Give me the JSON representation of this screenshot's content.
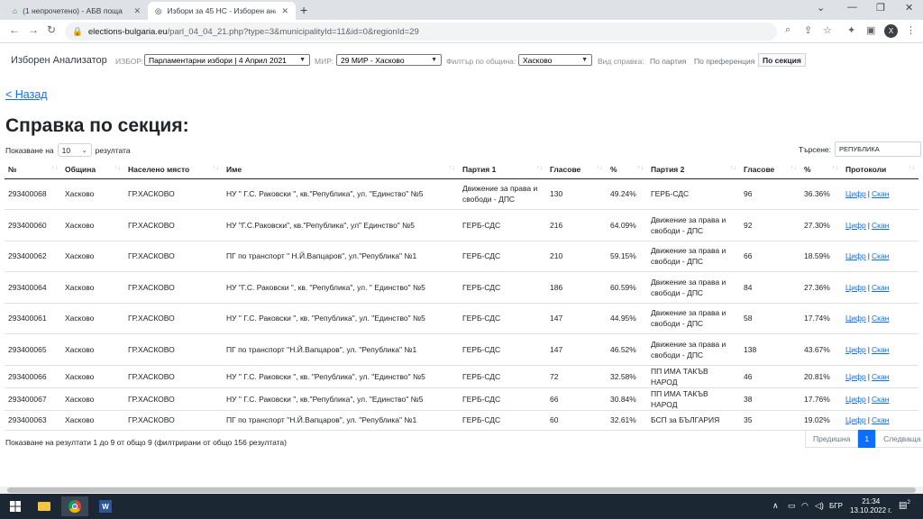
{
  "browser": {
    "tabs": [
      {
        "title": "(1 непрочетено) - АБВ поща"
      },
      {
        "title": "Избори за 45 НС - Изборен ана"
      }
    ],
    "url_domain": "elections-bulgaria.eu",
    "url_path": "/parl_04_04_21.php?type=3&municipalityId=11&id=0&regionId=29"
  },
  "nav": {
    "brand": "Изборен Анализатор",
    "election_label": "ИЗБОР:",
    "election_value": "Парламентарни избори | 4 Април 2021",
    "mir_label": "МИР:",
    "mir_value": "29 МИР - Хасково",
    "municipality_label": "Филтър по община:",
    "municipality_value": "Хасково",
    "report_label": "Вид справка:",
    "report_party": "По партия",
    "report_pref": "По преференция",
    "report_section": "По секция"
  },
  "page": {
    "back": "< Назад",
    "title": "Справка по секция:",
    "show_prefix": "Показване на",
    "show_count": "10",
    "show_suffix": "резултата",
    "search_label": "Търсене:",
    "search_value": "РЕПУБЛИКА"
  },
  "table": {
    "headers": [
      "№",
      "Община",
      "Населено място",
      "Име",
      "Партия 1",
      "Гласове",
      "%",
      "Партия 2",
      "Гласове",
      "%",
      "Протоколи"
    ],
    "rows": [
      [
        "293400068",
        "Хасково",
        "ГР.ХАСКОВО",
        "НУ \" Г.С. Раковски \", кв.\"Република\", ул. \"Единство\" №5",
        "Движение за права и свободи - ДПС",
        "130",
        "49.24%",
        "ГЕРБ-СДС",
        "96",
        "36.36%"
      ],
      [
        "293400060",
        "Хасково",
        "ГР.ХАСКОВО",
        "НУ \"Г.С.Раковски\", кв.\"Република\", ул\" Единство\" №5",
        "ГЕРБ-СДС",
        "216",
        "64.09%",
        "Движение за права и свободи - ДПС",
        "92",
        "27.30%"
      ],
      [
        "293400062",
        "Хасково",
        "ГР.ХАСКОВО",
        "ПГ по транспорт \" Н.Й.Вапцаров\", ул.\"Република\" №1",
        "ГЕРБ-СДС",
        "210",
        "59.15%",
        "Движение за права и свободи - ДПС",
        "66",
        "18.59%"
      ],
      [
        "293400064",
        "Хасково",
        "ГР.ХАСКОВО",
        "НУ \"Г.С. Раковски \", кв. \"Република\", ул. \" Единство\" №5",
        "ГЕРБ-СДС",
        "186",
        "60.59%",
        "Движение за права и свободи - ДПС",
        "84",
        "27.36%"
      ],
      [
        "293400061",
        "Хасково",
        "ГР.ХАСКОВО",
        "НУ \" Г.С. Раковски \", кв. \"Република\", ул. \"Единство\" №5",
        "ГЕРБ-СДС",
        "147",
        "44.95%",
        "Движение за права и свободи - ДПС",
        "58",
        "17.74%"
      ],
      [
        "293400065",
        "Хасково",
        "ГР.ХАСКОВО",
        "ПГ по транспорт \"Н.Й.Вапцаров\", ул. \"Република\" №1",
        "ГЕРБ-СДС",
        "147",
        "46.52%",
        "Движение за права и свободи - ДПС",
        "138",
        "43.67%"
      ],
      [
        "293400066",
        "Хасково",
        "ГР.ХАСКОВО",
        "НУ \" Г.С. Раковски \", кв. \"Република\", ул. \"Единство\" №5",
        "ГЕРБ-СДС",
        "72",
        "32.58%",
        "ПП ИМА ТАКЪВ НАРОД",
        "46",
        "20.81%"
      ],
      [
        "293400067",
        "Хасково",
        "ГР.ХАСКОВО",
        "НУ \" Г.С. Раковски \", кв.\"Република\", ул. \"Единство\" №5",
        "ГЕРБ-СДС",
        "66",
        "30.84%",
        "ПП ИМА ТАКЪВ НАРОД",
        "38",
        "17.76%"
      ],
      [
        "293400063",
        "Хасково",
        "ГР.ХАСКОВО",
        "ПГ по транспорт \"Н.Й.Вапцаров\", ул. \"Република\" №1",
        "ГЕРБ-СДС",
        "60",
        "32.61%",
        "БСП за БЪЛГАРИЯ",
        "35",
        "19.02%"
      ]
    ],
    "link_digital": "Цифр",
    "link_sep": "|",
    "link_scan": "Скан"
  },
  "footer": {
    "info": "Показване на резултати 1 до 9 от общо 9 (филтрирани от общо 156 резултата)",
    "prev": "Предишна",
    "page": "1",
    "next": "Следваща"
  },
  "taskbar": {
    "lang": "БГР",
    "time": "21:34",
    "date": "13.10.2022 г.",
    "notif_count": "2"
  }
}
